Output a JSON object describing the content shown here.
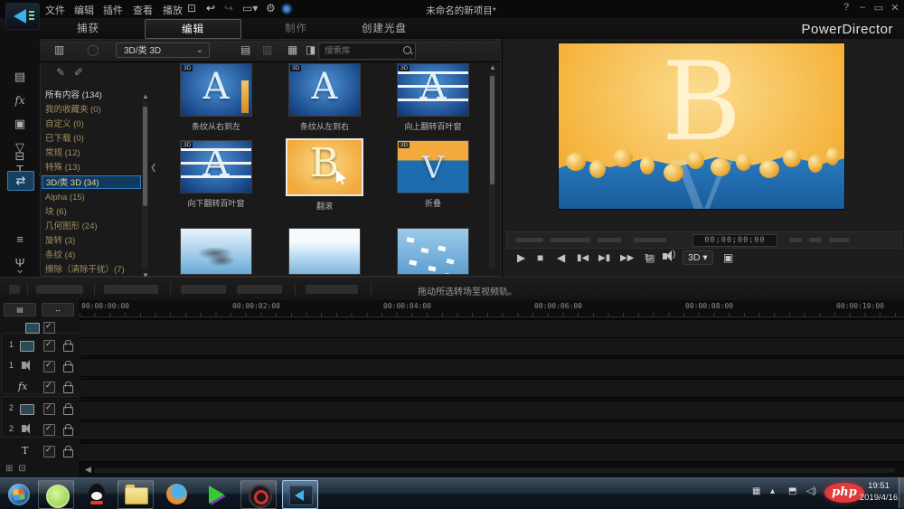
{
  "window": {
    "title": "未命名的新项目*",
    "brand": "PowerDirector",
    "controls": {
      "help": "?",
      "minimize": "–",
      "maximize": "▭",
      "close": "✕"
    }
  },
  "menu": {
    "items": [
      "文件",
      "编辑",
      "插件",
      "查看",
      "播放"
    ]
  },
  "tabs": {
    "capture": "捕获",
    "edit": "编辑",
    "produce": "制作",
    "create_disc": "创建光盘"
  },
  "rooms": {
    "effect_label": "fx",
    "title_label": "T"
  },
  "library": {
    "filter_dropdown": "3D/类 3D",
    "search_placeholder": "搜索库",
    "categories": [
      "所有内容 (134)",
      "我的收藏夹 (0)",
      "自定义 (0)",
      "已下载 (0)",
      "常规 (12)",
      "特殊 (13)",
      "3D/类 3D (34)",
      "Alpha (15)",
      "块 (6)",
      "几何图形 (24)",
      "旋转 (3)",
      "条纹 (4)",
      "擦除（清除干扰）(7)"
    ],
    "transitions": [
      {
        "name": "条纹从右到左",
        "letter": "A",
        "badge": "3D"
      },
      {
        "name": "条纹从左到右",
        "letter": "A",
        "badge": "3D"
      },
      {
        "name": "向上翻转百叶窗",
        "letter": "A",
        "badge": "3D"
      },
      {
        "name": "向下翻转百叶窗",
        "letter": "A",
        "badge": "3D"
      },
      {
        "name": "翻滚",
        "letter": "B",
        "badge": "3D",
        "selected": true
      },
      {
        "name": "折叠",
        "letter": "V",
        "badge": "3D"
      }
    ]
  },
  "preview": {
    "timecode": "00;00;00;00",
    "letter_b": "B",
    "letter_v": "V",
    "transport": {
      "play": "▶",
      "stop": "■",
      "prev": "◀",
      "step_back": "▮◀",
      "step_fwd": "▶▮",
      "next": "▶▶",
      "loop": "↻"
    },
    "quality_icon": "▤",
    "threed_button": "3D ▾",
    "export_icon": "▣"
  },
  "action_bar": {
    "tip": "拖动所选转场至视频轨。"
  },
  "timeline": {
    "ruler_labels": [
      "00:00:00:00",
      "00:00:02:00",
      "00:00:04:00",
      "00:00:06:00",
      "00:00:08:00",
      "00:00:10:00"
    ],
    "fit_button": "↔",
    "track_manager_icon": "▤",
    "tracks": [
      {
        "label": ""
      },
      {
        "label": "1"
      },
      {
        "label": "1"
      },
      {
        "label": "fx"
      },
      {
        "label": "2"
      },
      {
        "label": "2"
      },
      {
        "label": "T"
      }
    ]
  },
  "taskbar": {
    "time": "19:51",
    "date": "2019/4/16",
    "watermark": "php"
  },
  "icons": {
    "select": "⊡",
    "undo": "↩",
    "redo": "↪",
    "aspect": "▭▾",
    "gear": "⚙",
    "account": "◉",
    "import": "▥",
    "download": "◯",
    "copy": "▤",
    "paste": "▥",
    "grid": "▦",
    "split": "◨",
    "dropdown_caret": "⌄",
    "scroll_up": "▲",
    "scroll_down": "▼",
    "collapse_left": "❮",
    "media_room": "▤",
    "pip_room": "▣",
    "particle_room": "▽",
    "transition_room": "⇄",
    "mixing_room": "≡",
    "chapter_room": "▢",
    "subtitle_room": "⊟",
    "more_rooms": "≋",
    "zoom_in": "⊞",
    "zoom_out": "⊟",
    "scroll_left": "◀",
    "colors": {
      "accent_blue": "#2e7cc3",
      "selected_gold": "#e3d488",
      "preview_orange": "#f5b53f",
      "preview_blue": "#1f6fb5"
    }
  }
}
